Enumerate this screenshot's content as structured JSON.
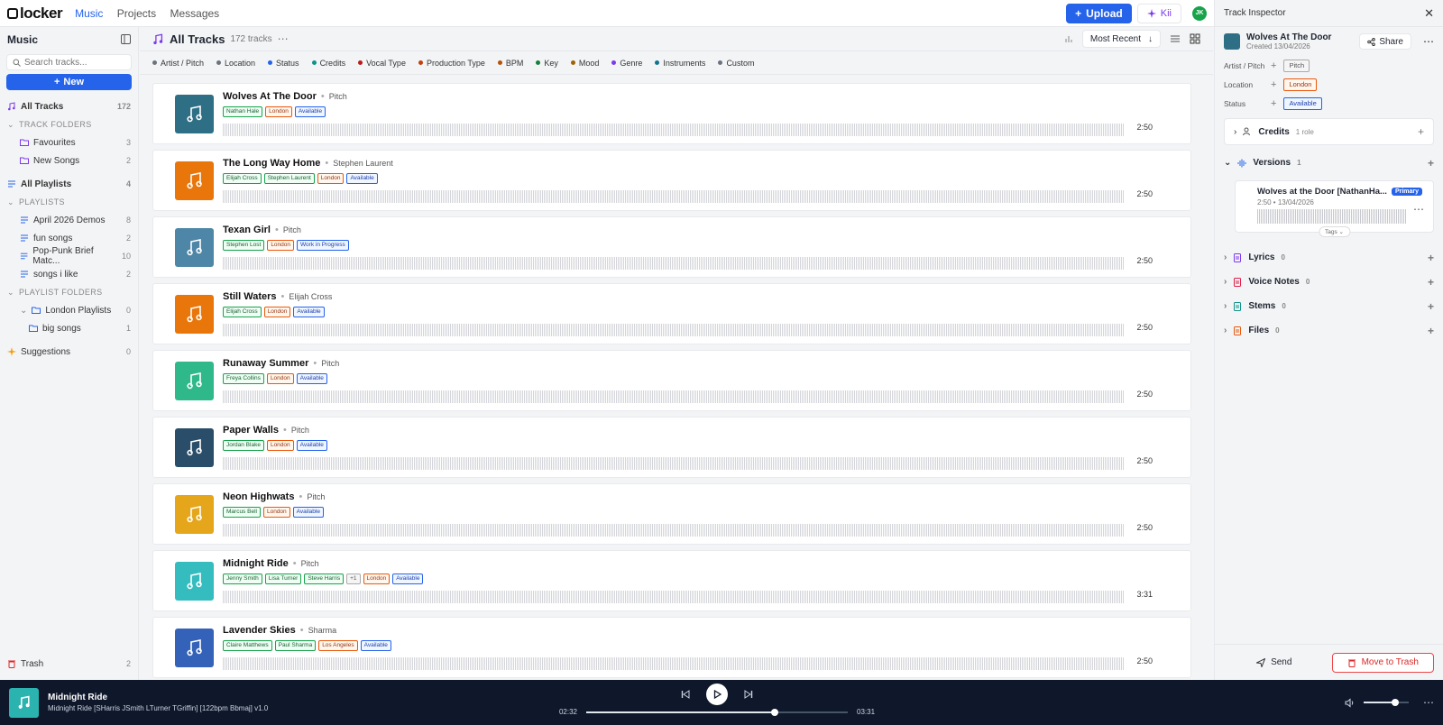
{
  "app": {
    "logo": "locker"
  },
  "nav": {
    "music": "Music",
    "projects": "Projects",
    "messages": "Messages"
  },
  "topbar": {
    "upload": "Upload",
    "kii": "Kii",
    "avatar": "JK"
  },
  "sidebar": {
    "title": "Music",
    "search_placeholder": "Search tracks...",
    "new_label": "New",
    "all_tracks": {
      "label": "All Tracks",
      "count": "172"
    },
    "track_folders_label": "TRACK FOLDERS",
    "track_folders": [
      {
        "label": "Favourites",
        "count": "3"
      },
      {
        "label": "New Songs",
        "count": "2"
      }
    ],
    "all_playlists": {
      "label": "All Playlists",
      "count": "4"
    },
    "playlists_label": "PLAYLISTS",
    "playlists": [
      {
        "label": "April 2026 Demos",
        "count": "8"
      },
      {
        "label": "fun songs",
        "count": "2"
      },
      {
        "label": "Pop-Punk Brief Matc...",
        "count": "10"
      },
      {
        "label": "songs i like",
        "count": "2"
      }
    ],
    "playlist_folders_label": "PLAYLIST FOLDERS",
    "playlist_folders": [
      {
        "label": "London Playlists",
        "count": "0"
      }
    ],
    "sub_folders": [
      {
        "label": "big songs",
        "count": "1"
      }
    ],
    "suggestions": {
      "label": "Suggestions",
      "count": "0"
    },
    "trash": {
      "label": "Trash",
      "count": "2"
    }
  },
  "main": {
    "title": "All Tracks",
    "count_label": "172 tracks",
    "sort_label": "Most Recent",
    "filters": [
      {
        "label": "Artist / Pitch",
        "color": "#6b7280"
      },
      {
        "label": "Location",
        "color": "#6b7280"
      },
      {
        "label": "Status",
        "color": "#2563eb"
      },
      {
        "label": "Credits",
        "color": "#0d9488"
      },
      {
        "label": "Vocal Type",
        "color": "#b91c1c"
      },
      {
        "label": "Production Type",
        "color": "#c2410c"
      },
      {
        "label": "BPM",
        "color": "#b45309"
      },
      {
        "label": "Key",
        "color": "#15803d"
      },
      {
        "label": "Mood",
        "color": "#a16207"
      },
      {
        "label": "Genre",
        "color": "#7c3aed"
      },
      {
        "label": "Instruments",
        "color": "#0e7490"
      },
      {
        "label": "Custom",
        "color": "#6b7280"
      }
    ]
  },
  "tracks": [
    {
      "name": "Wolves At The Door",
      "artist": "Pitch",
      "duration": "2:50",
      "art_color": "#2f6f86",
      "tags": [
        {
          "text": "Nathan Hale",
          "type": "green"
        },
        {
          "text": "London",
          "type": "orange"
        },
        {
          "text": "Available",
          "type": "blue"
        }
      ]
    },
    {
      "name": "The Long Way Home",
      "artist": "Stephen Laurent",
      "duration": "2:50",
      "art_color": "#e8760b",
      "tags": [
        {
          "text": "Elijah Cross",
          "type": "green"
        },
        {
          "text": "Stephen Laurent",
          "type": "green"
        },
        {
          "text": "London",
          "type": "orange"
        },
        {
          "text": "Available",
          "type": "blue"
        }
      ]
    },
    {
      "name": "Texan Girl",
      "artist": "Pitch",
      "duration": "2:50",
      "art_color": "#4d86a6",
      "tags": [
        {
          "text": "Stephen Lost",
          "type": "green"
        },
        {
          "text": "London",
          "type": "orange"
        },
        {
          "text": "Work in Progress",
          "type": "blue"
        }
      ]
    },
    {
      "name": "Still Waters",
      "artist": "Elijah Cross",
      "duration": "2:50",
      "art_color": "#e8760b",
      "tags": [
        {
          "text": "Elijah Cross",
          "type": "green"
        },
        {
          "text": "London",
          "type": "orange"
        },
        {
          "text": "Available",
          "type": "blue"
        }
      ]
    },
    {
      "name": "Runaway Summer",
      "artist": "Pitch",
      "duration": "2:50",
      "art_color": "#2fb98a",
      "tags": [
        {
          "text": "Freya Collins",
          "type": "green"
        },
        {
          "text": "London",
          "type": "orange"
        },
        {
          "text": "Available",
          "type": "blue"
        }
      ]
    },
    {
      "name": "Paper Walls",
      "artist": "Pitch",
      "duration": "2:50",
      "art_color": "#2a4d69",
      "tags": [
        {
          "text": "Jordan Blake",
          "type": "green"
        },
        {
          "text": "London",
          "type": "orange"
        },
        {
          "text": "Available",
          "type": "blue"
        }
      ]
    },
    {
      "name": "Neon Highwats",
      "artist": "Pitch",
      "duration": "2:50",
      "art_color": "#e5a61b",
      "tags": [
        {
          "text": "Marcus Bell",
          "type": "green"
        },
        {
          "text": "London",
          "type": "orange"
        },
        {
          "text": "Available",
          "type": "blue"
        }
      ]
    },
    {
      "name": "Midnight Ride",
      "artist": "Pitch",
      "duration": "3:31",
      "art_color": "#34bcbf",
      "tags": [
        {
          "text": "Jenny Smith",
          "type": "green"
        },
        {
          "text": "Lisa Turner",
          "type": "green"
        },
        {
          "text": "Steve Harris",
          "type": "green"
        },
        {
          "text": "+1",
          "type": "gray"
        },
        {
          "text": "London",
          "type": "orange"
        },
        {
          "text": "Available",
          "type": "blue"
        }
      ]
    },
    {
      "name": "Lavender Skies",
      "artist": "Sharma",
      "duration": "2:50",
      "art_color": "#3462b8",
      "tags": [
        {
          "text": "Claire Matthews",
          "type": "green"
        },
        {
          "text": "Paul Sharma",
          "type": "green"
        },
        {
          "text": "Los Angeles",
          "type": "orange"
        },
        {
          "text": "Available",
          "type": "blue"
        }
      ]
    }
  ],
  "inspector": {
    "title": "Track Inspector",
    "track_name": "Wolves At The Door",
    "created": "Created 13/04/2026",
    "share": "Share",
    "props": [
      {
        "label": "Artist / Pitch",
        "value": "Pitch",
        "type": "gray"
      },
      {
        "label": "Location",
        "value": "London",
        "type": "orange"
      },
      {
        "label": "Status",
        "value": "Available",
        "type": "blue"
      }
    ],
    "credits": {
      "label": "Credits",
      "sub": "1 role"
    },
    "versions": {
      "label": "Versions",
      "count": "1"
    },
    "version": {
      "name": "Wolves at the Door [NathanHa...",
      "badge": "Primary",
      "meta": "2:50 • 13/04/2026",
      "tags": "Tags"
    },
    "sections": [
      {
        "label": "Lyrics",
        "count": "0",
        "icon": "#7c3aed"
      },
      {
        "label": "Voice Notes",
        "count": "0",
        "icon": "#e11d48"
      },
      {
        "label": "Stems",
        "count": "0",
        "icon": "#0d9488"
      },
      {
        "label": "Files",
        "count": "0",
        "icon": "#ea580c"
      }
    ],
    "send": "Send",
    "trash": "Move to Trash"
  },
  "player": {
    "title": "Midnight Ride",
    "subtitle": "Midnight Ride [SHarris JSmith LTurner TGriffin] [122bpm Bbmaj] v1.0",
    "elapsed": "02:32",
    "total": "03:31",
    "progress": 0.72,
    "volume": 0.7
  }
}
